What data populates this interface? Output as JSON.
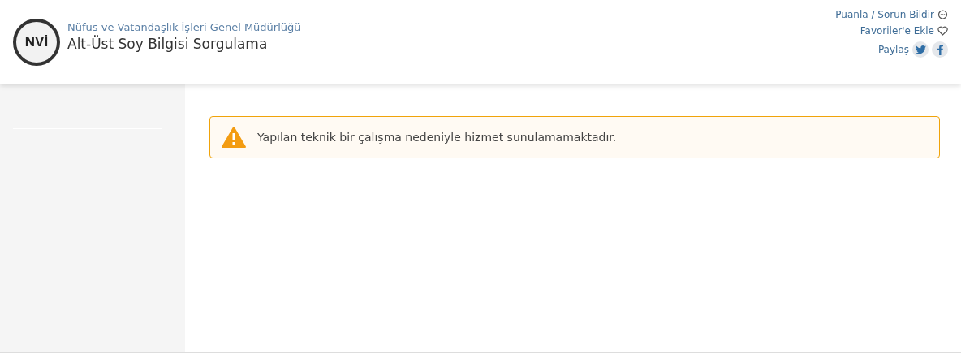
{
  "header": {
    "logo_text": "NVİ",
    "organization": "Nüfus ve Vatandaşlık İşleri Genel Müdürlüğü",
    "title": "Alt-Üst Soy Bilgisi Sorgulama",
    "links": [
      {
        "label": "Puanla / Sorun Bildir",
        "kind": "feedback"
      },
      {
        "label": "Favoriler'e Ekle",
        "kind": "favorite"
      },
      {
        "label": "Paylaş",
        "kind": "share"
      }
    ]
  },
  "alert": {
    "kind": "warning",
    "message": "Yapılan teknik bir çalışma nedeniyle hizmet sunulamamaktadır."
  }
}
